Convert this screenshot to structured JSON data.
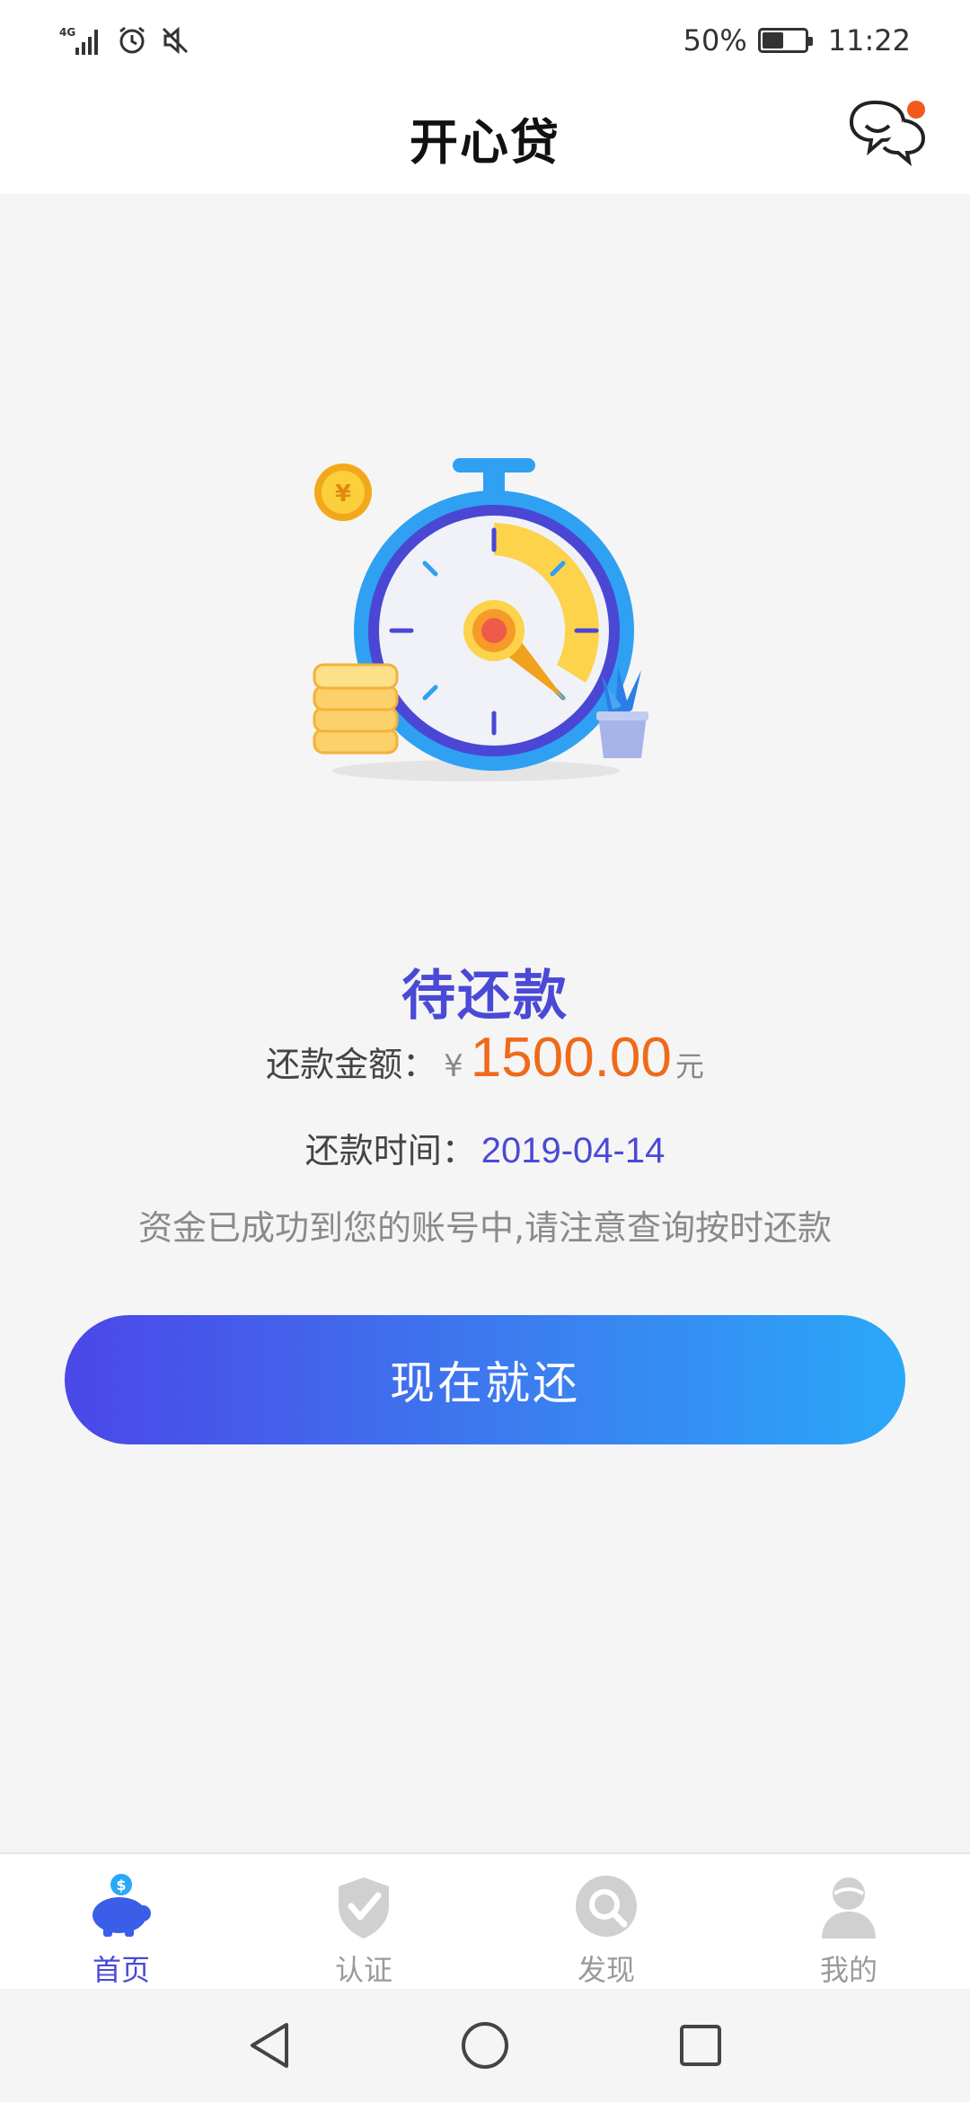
{
  "status_bar": {
    "network": "4G",
    "battery_text": "50%",
    "battery_level": 0.5,
    "time": "11:22"
  },
  "header": {
    "title": "开心贷",
    "message_icon": "chat-bubble-icon",
    "has_notification": true
  },
  "loan": {
    "status_title": "待还款",
    "amount_label": "还款金额：",
    "currency_symbol": "¥",
    "amount": "1500.00",
    "amount_unit": "元",
    "date_label": "还款时间：",
    "date": "2019-04-14",
    "notice": "资金已成功到您的账号中,请注意查询按时还款",
    "repay_button": "现在就还"
  },
  "bottom_nav": {
    "items": [
      {
        "label": "首页",
        "icon": "piggy-bank-icon",
        "active": true
      },
      {
        "label": "认证",
        "icon": "shield-check-icon",
        "active": false
      },
      {
        "label": "发现",
        "icon": "discover-icon",
        "active": false
      },
      {
        "label": "我的",
        "icon": "user-icon",
        "active": false
      }
    ]
  },
  "colors": {
    "accent": "#4a4ad6",
    "amount": "#ef6a1a",
    "button_start": "#4b47e8",
    "button_end": "#2aa8f8",
    "notification_dot": "#f05a1a"
  }
}
